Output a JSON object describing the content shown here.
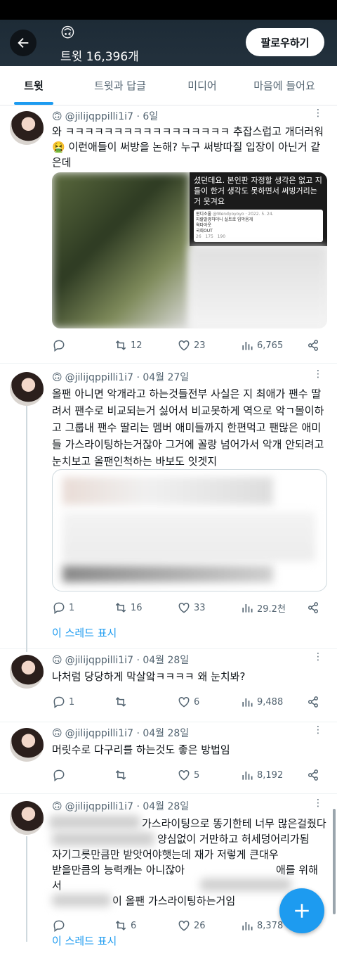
{
  "header": {
    "emoji": "🙃",
    "tweet_count": "트윗 16,396개",
    "follow_label": "팔로우하기"
  },
  "tabs": [
    "트윗",
    "트윗과 답글",
    "미디어",
    "마음에 들어요"
  ],
  "tweets": [
    {
      "emoji": "🙃",
      "handle": "@jilijqppilli1i7",
      "time": "· 6일",
      "text": "와 ㅋㅋㅋㅋㅋㅋㅋㅋㅋㅋㅋㅋㅋㅋㅋㅋㅋ 추잡스럽고 개더러워🤮 이런애들이 써방을 논해? 누구 써방따질 입장이 아닌거 같은데",
      "media_text": "셨던데요. 본인판 자정할 생각은 없고 지들이 한거 생각도 못하면서 써빙거리는거 웃겨요",
      "media_inner_name": "윈디소울",
      "media_inner_handle": "@Wendyoyoyo · 2022. 5. 24.",
      "media_inner_lines": [
        "지랄발광하더니 실트로 입막음게",
        "웍타아웃",
        "국희OUT"
      ],
      "media_inner_counts": [
        "26",
        "175",
        "190"
      ],
      "replies": "",
      "retweets": "12",
      "likes": "23",
      "views": "6,765"
    },
    {
      "emoji": "🙃",
      "handle": "@jilijqppilli1i7",
      "time": "· 04월 27일",
      "text": "올팬 아니면 악개라고 하는것들전부 사실은 지 최애가 팬수 딸려서 팬수로 비교되는거 싫어서 비교못하게 역으로 악ㄱ몰이하고 그룹내 팬수 딸리는 멤버 애미들까지 한편먹고 팬많은 애미들 가스라이팅하는거잖아 그거에 꼴랑 넘어가서 악개 안되려고눈치보고 올팬인척하는 바보도 잇겟지",
      "replies": "1",
      "retweets": "16",
      "likes": "33",
      "views": "29.2천",
      "thread": "이 스레드 표시"
    },
    {
      "emoji": "🙃",
      "handle": "@jilijqppilli1i7",
      "time": "· 04월 28일",
      "text": "나처럼 당당하게 막살앜ㅋㅋㅋㅋ 왜 눈치봐?",
      "replies": "1",
      "retweets": "",
      "likes": "6",
      "views": "9,488"
    },
    {
      "emoji": "🙃",
      "handle": "@jilijqppilli1i7",
      "time": "· 04월 28일",
      "text": "머릿수로 다구리를 하는것도 좋은 방법임",
      "replies": "",
      "retweets": "",
      "likes": "5",
      "views": "8,192"
    },
    {
      "emoji": "🙃",
      "handle": "@jilijqppilli1i7",
      "time": "· 04월 28일",
      "line1": "가스라이팅으로 똥기한테 너무 많은걸줬다",
      "line2": "양심없이 거만하고 허세덩어리가됨",
      "line3": "자기그릇만큼만 받앗어야햇는데 재가 저렇게 큰대우",
      "line4": "받을만큼의 능력캐는 아니잖아",
      "line4b": "애를 위해서",
      "line5": "이 올팬 가스라이팅하는거임",
      "replies": "",
      "retweets": "6",
      "likes": "26",
      "views": "8,378",
      "thread": "이 스레드 표시"
    }
  ],
  "colors": {
    "accent": "#1d9bf0",
    "header_bg": "#1d2b36",
    "text_secondary": "#536471"
  }
}
